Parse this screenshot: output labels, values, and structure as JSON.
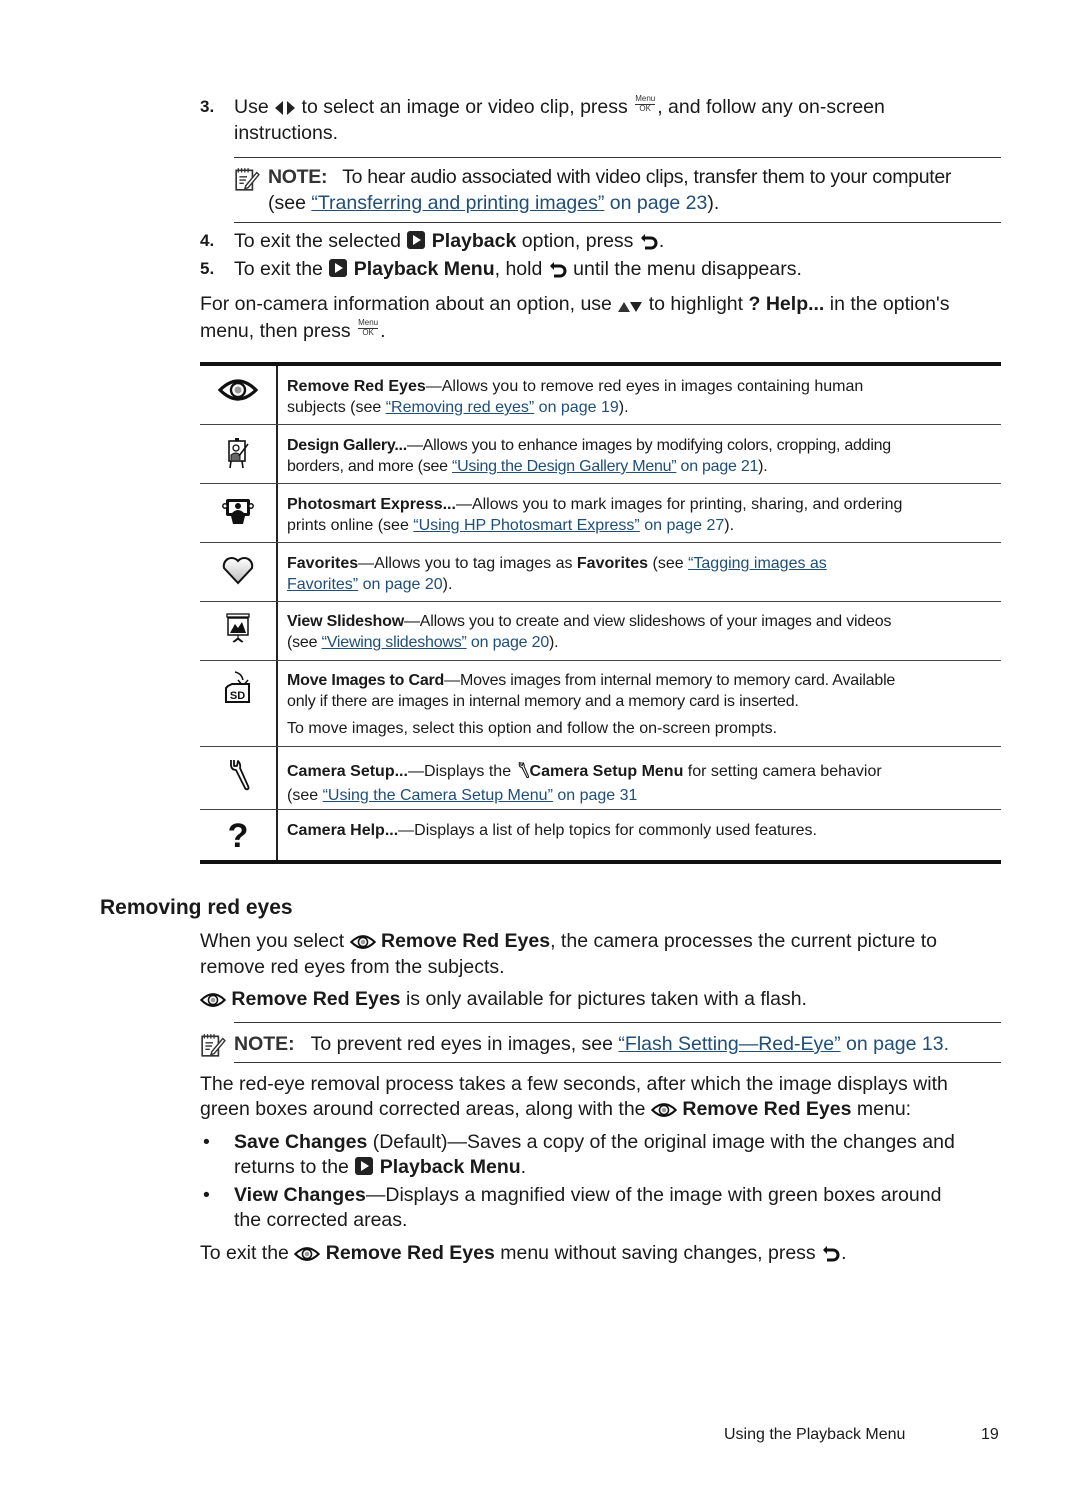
{
  "steps": [
    {
      "number": "3.",
      "parts": [
        "Use",
        "to select an image or video clip, press",
        ", and follow any on-screen",
        "instructions."
      ],
      "menu_ok": {
        "top": "Menu",
        "bottom": "OK"
      }
    },
    {
      "number": "4.",
      "text_before": "To exit the selected",
      "bold": "Playback",
      "text_after": "option, press",
      "end": "."
    },
    {
      "number": "5.",
      "text_before": "To exit the",
      "bold": "Playback Menu",
      "text_mid": ", hold",
      "text_after": "until the menu disappears."
    }
  ],
  "note1": {
    "label": "NOTE:",
    "text": "To hear audio associated with video clips, transfer them to your computer",
    "line2_prefix": "(see ",
    "link": "“Transferring and printing images”",
    "link_suffix": " on page 23",
    "end": ")."
  },
  "help_para": {
    "before": "For on-camera information about an option, use",
    "mid": "to highlight",
    "bold": "Help...",
    "after": "in the option's",
    "line2": "menu, then press",
    "end": "."
  },
  "table": {
    "rows": [
      {
        "icon": "eye-icon",
        "title": "Remove Red Eyes",
        "desc": "—Allows you to remove red eyes in images containing human",
        "line2_prefix": "subjects (see ",
        "link": "“Removing red eyes”",
        "link_suffix": " on page 19",
        "end": ")."
      },
      {
        "icon": "easel-icon",
        "title": "Design Gallery...",
        "desc": "—Allows you to enhance images by modifying colors, cropping, adding",
        "line2_prefix": "borders, and more (see ",
        "link": "“Using the Design Gallery Menu”",
        "link_suffix": " on page 21",
        "end": ")."
      },
      {
        "icon": "photosmart-icon",
        "title": "Photosmart Express...",
        "desc": "—Allows you to mark images for printing, sharing, and ordering",
        "line2_prefix": "prints online (see ",
        "link": "“Using HP Photosmart Express”",
        "link_suffix": " on page 27",
        "end": ")."
      },
      {
        "icon": "heart-icon",
        "title": "Favorites",
        "desc": "—Allows you to tag images as ",
        "desc_bold": "Favorites",
        "desc_after": " (see ",
        "link_line1": "“Tagging images as",
        "link_line2": "Favorites”",
        "link_suffix": " on page 20",
        "end": ")."
      },
      {
        "icon": "slideshow-icon",
        "title": "View Slideshow",
        "desc": "—Allows you to create and view slideshows of your images and videos",
        "line2_prefix": "(see ",
        "link": "“Viewing slideshows”",
        "link_suffix": " on page 20",
        "end": ")."
      },
      {
        "icon": "sd-card-icon",
        "title": "Move Images to Card",
        "desc": "—Moves images from internal memory to memory card. Available",
        "line2": "only if there are images in internal memory and a memory card is inserted.",
        "extra": "To move images, select this option and follow the on-screen prompts."
      },
      {
        "icon": "wrench-icon",
        "title": "Camera Setup...",
        "desc": "—Displays the ",
        "desc_bold": "Camera Setup Menu",
        "desc_after": " for setting camera behavior",
        "line2_prefix": "(see ",
        "link": "“Using the Camera Setup Menu”",
        "link_suffix": " on page 31"
      },
      {
        "icon": "question-icon",
        "title": "Camera Help...",
        "desc": "—Displays a list of help topics for commonly used features."
      }
    ]
  },
  "section": {
    "heading": "Removing red eyes",
    "p1": {
      "before": "When you select",
      "bold": "Remove Red Eyes",
      "after": ", the camera processes the current picture to",
      "line2": "remove red eyes from the subjects."
    },
    "p2": {
      "bold": "Remove Red Eyes",
      "after": "is only available for pictures taken with a flash."
    },
    "note": {
      "label": "NOTE:",
      "text": "To prevent red eyes in images, see ",
      "link": "“Flash Setting—Red-Eye”",
      "link_suffix": " on page 13."
    },
    "p3": {
      "line1": "The red-eye removal process takes a few seconds, after which the image displays with",
      "line2_before": "green boxes around corrected areas, along with the",
      "bold": "Remove Red Eyes",
      "after": "menu:"
    },
    "bullets": [
      {
        "bold": "Save Changes",
        "text": " (Default)—Saves a copy of the original image with the changes and",
        "line2_before": "returns to the",
        "line2_bold": "Playback Menu",
        "end": "."
      },
      {
        "bold": "View Changes",
        "text": "—Displays a magnified view of the image with green boxes around",
        "line2": "the corrected areas."
      }
    ],
    "bullet_char": "•",
    "p4": {
      "before": "To exit the",
      "bold": "Remove Red Eyes",
      "after": "menu without saving changes, press",
      "end": "."
    }
  },
  "footer": {
    "title": "Using the Playback Menu",
    "page": "19"
  },
  "colors": {
    "link": "#1f4e79",
    "text": "#1a1a1a"
  }
}
